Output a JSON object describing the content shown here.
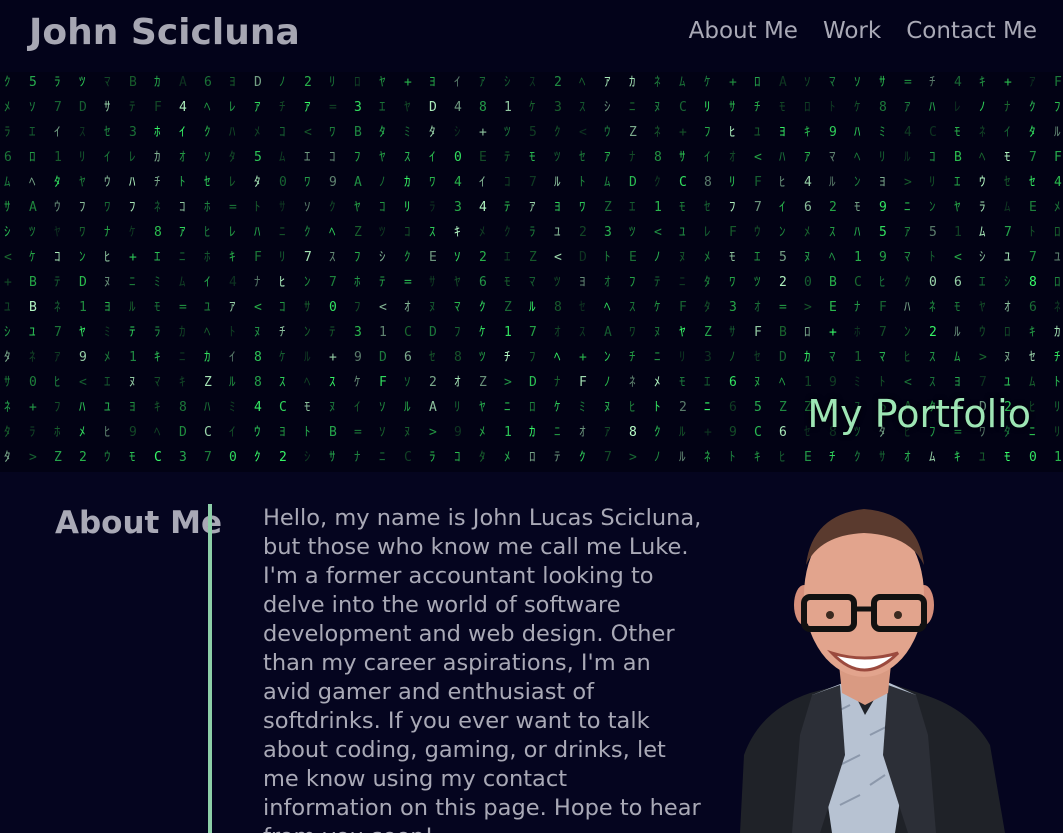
{
  "header": {
    "site_title": "John Scicluna",
    "nav": [
      {
        "label": "About Me"
      },
      {
        "label": "Work"
      },
      {
        "label": "Contact Me"
      }
    ]
  },
  "hero": {
    "title": "My Portfolio",
    "accent_color": "#9ee6b5",
    "rain_color": "#39ff6a"
  },
  "about": {
    "heading": "About Me",
    "paragraph": "Hello, my name is John Lucas Scicluna, but those who know me call me Luke. I'm a former accountant looking to delve into the world of software development and web design. Other than my career aspirations, I'm an avid gamer and enthusiast of softdrinks. If you ever want to talk about coding, gaming, or drinks, let me know using my contact information on this page. Hope to hear from you soon!",
    "divider_color": "#8dcfa8"
  },
  "icons": {
    "portrait": "profile-photo"
  }
}
